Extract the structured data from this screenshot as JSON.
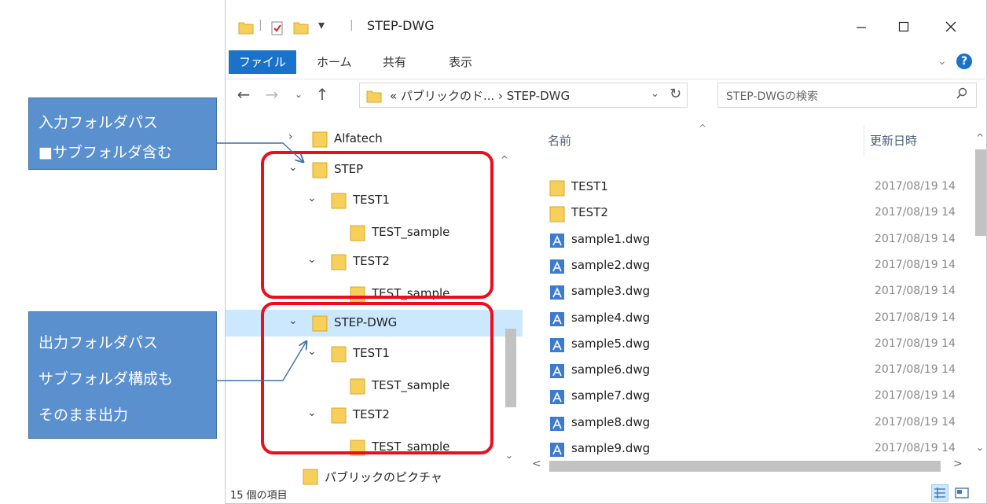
{
  "window": {
    "title": "STEP-DWG",
    "pin_glyph": "▾"
  },
  "ribbon": {
    "tabs": [
      "ファイル",
      "ホーム",
      "共有",
      "表示"
    ],
    "help": "?"
  },
  "address": {
    "path": "« パブリックのド... › STEP-DWG",
    "search_placeholder": "STEP-DWGの検索"
  },
  "nav_tree": [
    {
      "label": "Alfatech",
      "level": 1,
      "expanded": false
    },
    {
      "label": "STEP",
      "level": 1,
      "expanded": true
    },
    {
      "label": "TEST1",
      "level": 2,
      "expanded": true
    },
    {
      "label": "TEST_sample",
      "level": 3,
      "expanded": false
    },
    {
      "label": "TEST2",
      "level": 2,
      "expanded": true
    },
    {
      "label": "TEST_sample",
      "level": 3,
      "expanded": false
    },
    {
      "label": "STEP-DWG",
      "level": 1,
      "expanded": true,
      "selected": true
    },
    {
      "label": "TEST1",
      "level": 2,
      "expanded": true
    },
    {
      "label": "TEST_sample",
      "level": 3,
      "expanded": false
    },
    {
      "label": "TEST2",
      "level": 2,
      "expanded": true
    },
    {
      "label": "TEST_sample",
      "level": 3,
      "expanded": false
    },
    {
      "label": "パブリックのピクチャ",
      "level": 0,
      "expanded": false
    }
  ],
  "file_list": {
    "columns": {
      "name": "名前",
      "date": "更新日時"
    },
    "rows": [
      {
        "name": "TEST1",
        "type": "folder",
        "date": "2017/08/19 14"
      },
      {
        "name": "TEST2",
        "type": "folder",
        "date": "2017/08/19 14"
      },
      {
        "name": "sample1.dwg",
        "type": "dwg",
        "date": "2017/08/19 14"
      },
      {
        "name": "sample2.dwg",
        "type": "dwg",
        "date": "2017/08/19 14"
      },
      {
        "name": "sample3.dwg",
        "type": "dwg",
        "date": "2017/08/19 14"
      },
      {
        "name": "sample4.dwg",
        "type": "dwg",
        "date": "2017/08/19 14"
      },
      {
        "name": "sample5.dwg",
        "type": "dwg",
        "date": "2017/08/19 14"
      },
      {
        "name": "sample6.dwg",
        "type": "dwg",
        "date": "2017/08/19 14"
      },
      {
        "name": "sample7.dwg",
        "type": "dwg",
        "date": "2017/08/19 14"
      },
      {
        "name": "sample8.dwg",
        "type": "dwg",
        "date": "2017/08/19 14"
      },
      {
        "name": "sample9.dwg",
        "type": "dwg",
        "date": "2017/08/19 14"
      }
    ]
  },
  "status": {
    "count": "15 個の項目"
  },
  "callouts": {
    "input": [
      "入力フォルダパス",
      "■サブフォルダ含む"
    ],
    "output": [
      "出力フォルダパス",
      "サブフォルダ構成も",
      "そのまま出力"
    ]
  },
  "colors": {
    "accent": "#1a73c8",
    "folder": "#f7cf5b",
    "highlight_red": "#ee0c1d",
    "callout_blue": "#5b90cf",
    "selection": "#cce8ff"
  }
}
